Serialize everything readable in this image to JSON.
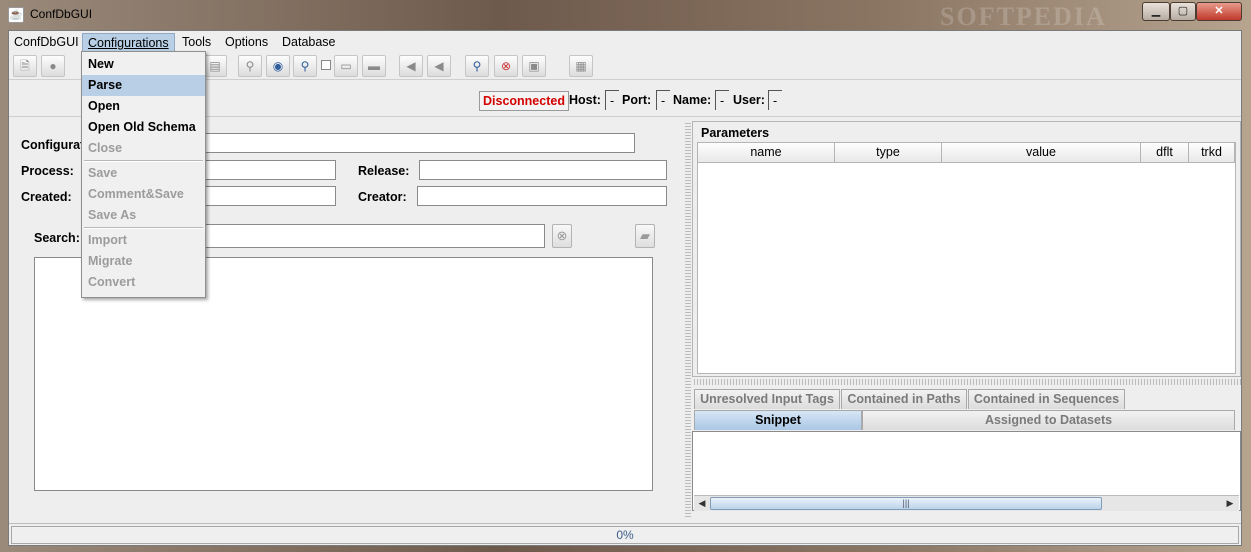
{
  "window": {
    "title": "ConfDbGUI",
    "watermark": "SOFTPEDIA",
    "controls": {
      "minimize": "▁",
      "maximize": "▢",
      "close": "✕"
    }
  },
  "menubar": [
    {
      "label": "ConfDbGUI"
    },
    {
      "label": "Configurations"
    },
    {
      "label": "Tools"
    },
    {
      "label": "Options"
    },
    {
      "label": "Database"
    }
  ],
  "configurations_menu": {
    "items": [
      {
        "label": "New",
        "enabled": true
      },
      {
        "label": "Parse",
        "enabled": true,
        "highlighted": true
      },
      {
        "label": "Open",
        "enabled": true
      },
      {
        "label": "Open Old Schema",
        "enabled": true
      },
      {
        "label": "Close",
        "enabled": false
      },
      {
        "label": "Save",
        "enabled": false
      },
      {
        "label": "Comment&Save",
        "enabled": false
      },
      {
        "label": "Save As",
        "enabled": false
      },
      {
        "label": "Import",
        "enabled": false
      },
      {
        "label": "Migrate",
        "enabled": false
      },
      {
        "label": "Convert",
        "enabled": false
      }
    ]
  },
  "connection": {
    "status": "Disconnected",
    "status_color": "#d40000",
    "host_label": "Host:",
    "host_value": "-",
    "port_label": "Port:",
    "port_value": "-",
    "name_label": "Name:",
    "name_value": "-",
    "user_label": "User:",
    "user_value": "-"
  },
  "config_form": {
    "configuration_label": "Configurati",
    "process_label": "Process:",
    "release_label": "Release:",
    "created_label": "Created:",
    "creator_label": "Creator:",
    "search_label": "Search:"
  },
  "parameters": {
    "title": "Parameters",
    "columns": [
      "name",
      "type",
      "value",
      "dflt",
      "trkd"
    ]
  },
  "tabs": {
    "row1": [
      "Unresolved Input Tags",
      "Contained in Paths",
      "Contained in Sequences"
    ],
    "row2": [
      {
        "label": "Snippet",
        "selected": true
      },
      {
        "label": "Assigned to Datasets",
        "selected": false
      }
    ]
  },
  "status": {
    "progress_text": "0%",
    "progress": 0
  },
  "colors": {
    "menu_highlight": "#b8cfe5",
    "disabled_text": "#9c9c9c",
    "accent": "#3d5f8e"
  }
}
